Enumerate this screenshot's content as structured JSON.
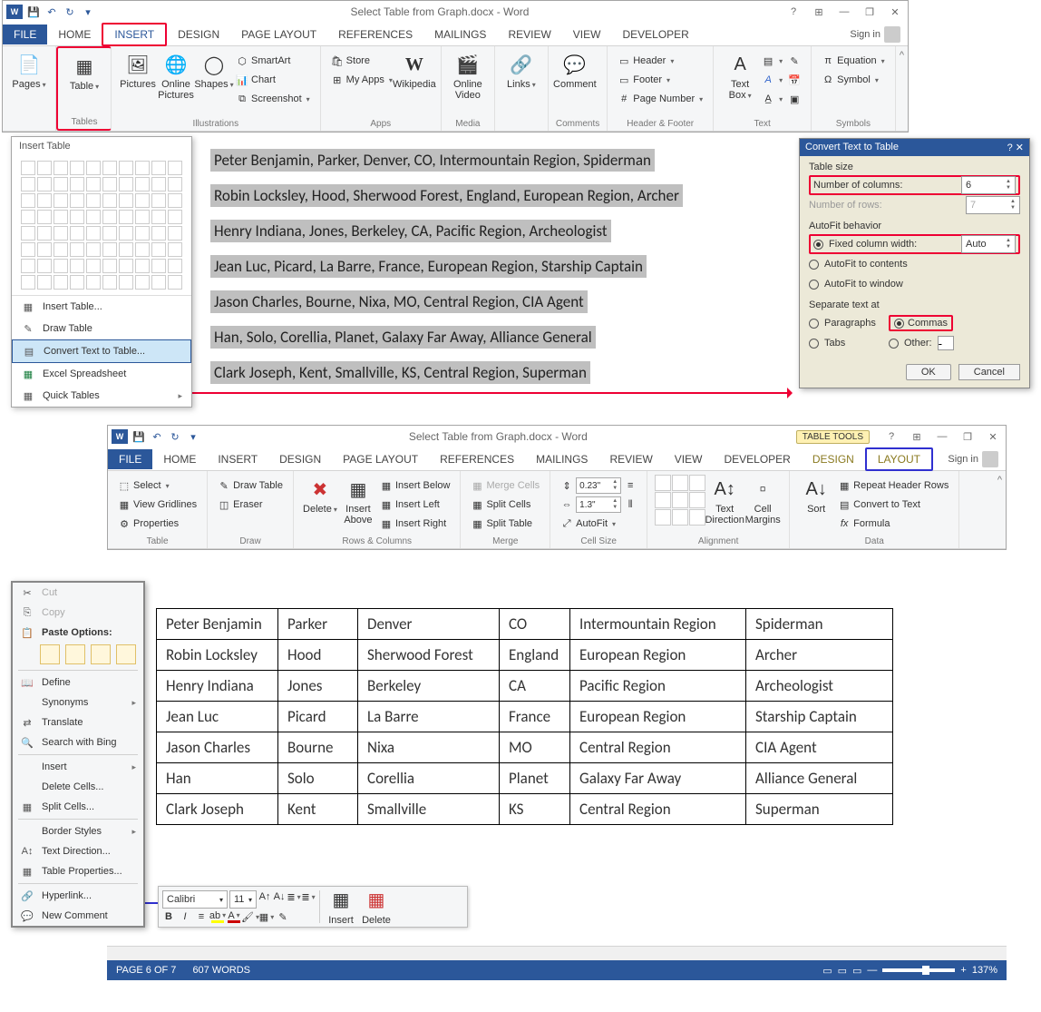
{
  "win1": {
    "title": "Select Table from Graph.docx - Word",
    "signin": "Sign in",
    "qat": {
      "save": "💾",
      "undo": "↶",
      "redo": "↻"
    },
    "tabs": [
      "FILE",
      "HOME",
      "INSERT",
      "DESIGN",
      "PAGE LAYOUT",
      "REFERENCES",
      "MAILINGS",
      "REVIEW",
      "VIEW",
      "DEVELOPER"
    ],
    "ribbon": {
      "pages": "Pages",
      "table": "Table",
      "tables_group": "Tables",
      "pictures": "Pictures",
      "online_pictures": "Online Pictures",
      "shapes": "Shapes",
      "smartart": "SmartArt",
      "chart": "Chart",
      "screenshot": "Screenshot",
      "illustrations_group": "Illustrations",
      "store": "Store",
      "myapps": "My Apps",
      "wikipedia": "Wikipedia",
      "apps_group": "Apps",
      "online_video": "Online Video",
      "media_group": "Media",
      "links": "Links",
      "comment": "Comment",
      "comments_group": "Comments",
      "header": "Header",
      "footer": "Footer",
      "page_number": "Page Number",
      "hf_group": "Header & Footer",
      "text_box": "Text Box",
      "text_group": "Text",
      "equation": "Equation",
      "symbol": "Symbol",
      "symbols_group": "Symbols"
    }
  },
  "insert_table": {
    "title": "Insert Table",
    "items": [
      "Insert Table...",
      "Draw Table",
      "Convert Text to Table...",
      "Excel Spreadsheet",
      "Quick Tables"
    ]
  },
  "doc_lines": [
    "Peter Benjamin, Parker, Denver, CO, Intermountain Region, Spiderman",
    "Robin Locksley, Hood, Sherwood Forest, England, European Region, Archer",
    "Henry Indiana, Jones, Berkeley, CA, Pacific Region, Archeologist",
    "Jean Luc, Picard, La Barre, France, European Region, Starship Captain",
    "Jason Charles, Bourne, Nixa, MO, Central Region, CIA Agent",
    "Han, Solo, Corellia, Planet, Galaxy Far Away, Alliance General",
    "Clark Joseph, Kent, Smallville, KS, Central Region, Superman"
  ],
  "dialog": {
    "title": "Convert Text to Table",
    "table_size": "Table size",
    "num_cols": "Number of columns:",
    "num_cols_val": "6",
    "num_rows": "Number of rows:",
    "num_rows_val": "7",
    "autofit": "AutoFit behavior",
    "fixed_width": "Fixed column width:",
    "fixed_val": "Auto",
    "autofit_contents": "AutoFit to contents",
    "autofit_window": "AutoFit to window",
    "separate": "Separate text at",
    "paragraphs": "Paragraphs",
    "commas": "Commas",
    "tabs": "Tabs",
    "other": "Other:",
    "ok": "OK",
    "cancel": "Cancel"
  },
  "win2": {
    "title": "Select Table from Graph.docx - Word",
    "table_tools": "TABLE TOOLS",
    "signin": "Sign in",
    "tabs": [
      "FILE",
      "HOME",
      "INSERT",
      "DESIGN",
      "PAGE LAYOUT",
      "REFERENCES",
      "MAILINGS",
      "REVIEW",
      "VIEW",
      "DEVELOPER",
      "DESIGN",
      "LAYOUT"
    ],
    "ribbon": {
      "select": "Select",
      "gridlines": "View Gridlines",
      "properties": "Properties",
      "table_group": "Table",
      "draw_table": "Draw Table",
      "eraser": "Eraser",
      "draw_group": "Draw",
      "delete": "Delete",
      "insert_above": "Insert Above",
      "insert_below": "Insert Below",
      "insert_left": "Insert Left",
      "insert_right": "Insert Right",
      "rows_group": "Rows & Columns",
      "merge_cells": "Merge Cells",
      "split_cells": "Split Cells",
      "split_table": "Split Table",
      "merge_group": "Merge",
      "height": "0.23\"",
      "width": "1.3\"",
      "autofit": "AutoFit",
      "cellsize_group": "Cell Size",
      "text_direction": "Text Direction",
      "cell_margins": "Cell Margins",
      "align_group": "Alignment",
      "sort": "Sort",
      "repeat_header": "Repeat Header Rows",
      "convert_text": "Convert to Text",
      "formula": "Formula",
      "data_group": "Data"
    }
  },
  "chart_data": {
    "type": "table",
    "rows": [
      [
        "Peter Benjamin",
        "Parker",
        "Denver",
        "CO",
        "Intermountain Region",
        "Spiderman"
      ],
      [
        "Robin Locksley",
        "Hood",
        "Sherwood Forest",
        "England",
        "European Region",
        "Archer"
      ],
      [
        "Henry Indiana",
        "Jones",
        "Berkeley",
        "CA",
        "Pacific Region",
        "Archeologist"
      ],
      [
        "Jean Luc",
        "Picard",
        "La Barre",
        "France",
        "European Region",
        "Starship Captain"
      ],
      [
        "Jason Charles",
        "Bourne",
        "Nixa",
        "MO",
        "Central Region",
        "CIA Agent"
      ],
      [
        "Han",
        "Solo",
        "Corellia",
        "Planet",
        "Galaxy Far Away",
        "Alliance General"
      ],
      [
        "Clark Joseph",
        "Kent",
        "Smallville",
        "KS",
        "Central Region",
        "Superman"
      ]
    ]
  },
  "ctx": {
    "cut": "Cut",
    "copy": "Copy",
    "paste_options": "Paste Options:",
    "define": "Define",
    "synonyms": "Synonyms",
    "translate": "Translate",
    "search_bing": "Search with Bing",
    "insert": "Insert",
    "delete_cells": "Delete Cells...",
    "split_cells": "Split Cells...",
    "border_styles": "Border Styles",
    "text_direction": "Text Direction...",
    "table_properties": "Table Properties...",
    "hyperlink": "Hyperlink...",
    "new_comment": "New Comment"
  },
  "minitb": {
    "font": "Calibri",
    "size": "11",
    "insert": "Insert",
    "delete": "Delete"
  },
  "status": {
    "page": "PAGE 6 OF 7",
    "words": "607 WORDS",
    "zoom": "137%"
  }
}
